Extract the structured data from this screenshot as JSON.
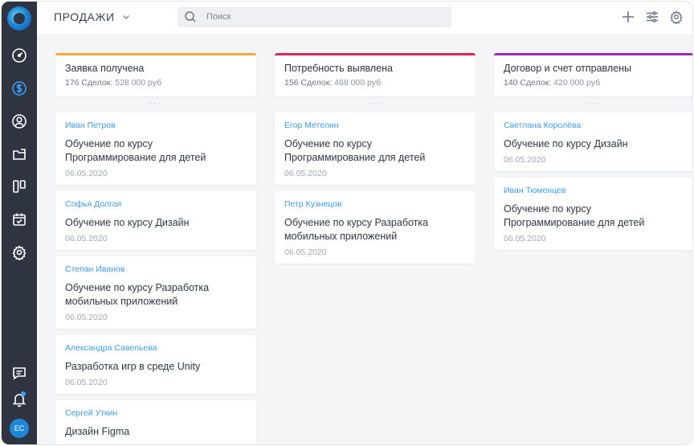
{
  "app": {
    "brand_color": "#1e88d8"
  },
  "sidebar": {
    "items": [
      {
        "icon": "gauge-icon"
      },
      {
        "icon": "dollar-icon",
        "active": true
      },
      {
        "icon": "user-circle-icon"
      },
      {
        "icon": "folder-icon"
      },
      {
        "icon": "columns-icon"
      },
      {
        "icon": "calendar-check-icon"
      },
      {
        "icon": "gear-icon"
      },
      {
        "icon": "chat-icon"
      },
      {
        "icon": "bell-icon"
      }
    ],
    "avatar_initials": "ЕС"
  },
  "header": {
    "title": "ПРОДАЖИ",
    "search_placeholder": "Поиск"
  },
  "columns": [
    {
      "title": "Заявка получена",
      "count_label": "176 Сделок:",
      "amount": "528 000 руб",
      "color": "#f4a93b",
      "cards": [
        {
          "name": "Иван Петров",
          "desc": "Обучение по курсу Программирование для детей",
          "date": "06.05.2020"
        },
        {
          "name": "Софья Долгая",
          "desc": "Обучение по курсу Дизайн",
          "date": "06.05.2020"
        },
        {
          "name": "Степан Иванов",
          "desc": "Обучение по курсу Разработка мобильных приложений",
          "date": "06.05.2020"
        },
        {
          "name": "Александра Савельева",
          "desc": "Разработка игр в среде Unity",
          "date": "06.05.2020"
        },
        {
          "name": "Сергей Уткин",
          "desc": "Дизайн Figma",
          "date": ""
        }
      ]
    },
    {
      "title": "Потребность выявлена",
      "count_label": "156 Сделок:",
      "amount": "468 000 руб",
      "color": "#e0245e",
      "cards": [
        {
          "name": "Егор Метелин",
          "desc": "Обучение по курсу Программирование для детей",
          "date": "06.05.2020"
        },
        {
          "name": "Петр Кузнецов",
          "desc": "Обучение по курсу Разработка мобильных приложений",
          "date": "06.05.2020"
        }
      ]
    },
    {
      "title": "Договор и счет отправлены",
      "count_label": "140 Сделок:",
      "amount": "420 000 руб",
      "color": "#9b2fb5",
      "cards": [
        {
          "name": "Светлана Королёва",
          "desc": "Обучение по курсу Дизайн",
          "date": "06.05.2020"
        },
        {
          "name": "Иван Тюменцев",
          "desc": "Обучение по курсу Программирование для детей",
          "date": "06.05.2020"
        }
      ]
    }
  ]
}
